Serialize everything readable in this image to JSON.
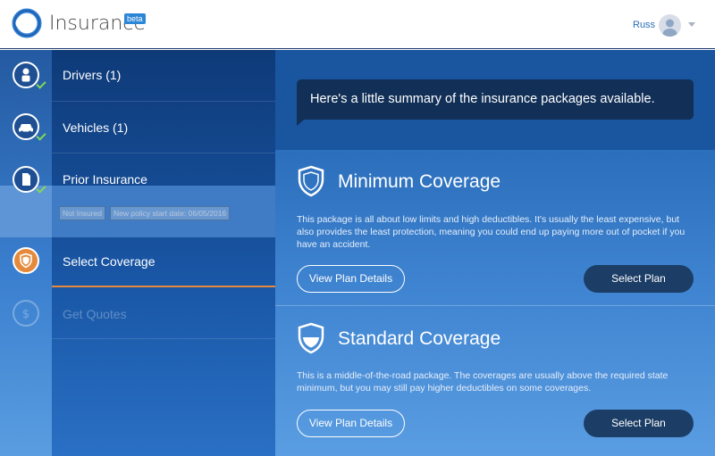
{
  "header": {
    "brand": "Insurance",
    "beta_label": "beta",
    "user_name": "Russ"
  },
  "sidebar": {
    "items": [
      {
        "label": "Drivers (1)",
        "icon": "person-icon",
        "completed": true
      },
      {
        "label": "Vehicles (1)",
        "icon": "car-icon",
        "completed": true
      },
      {
        "label": "Prior Insurance",
        "icon": "document-icon",
        "completed": true,
        "tags": [
          "Not Insured",
          "New policy start date: 06/05/2016"
        ]
      },
      {
        "label": "Select Coverage",
        "icon": "shield-icon",
        "active": true
      },
      {
        "label": "Get Quotes",
        "icon": "dollar-icon",
        "disabled": true
      }
    ]
  },
  "main": {
    "summary": "Here's a little summary of the insurance packages available.",
    "cards": [
      {
        "title": "Minimum Coverage",
        "description": "This package is all about low limits and high deductibles. It's usually the least expensive, but also provides the least protection, meaning you could end up paying more out of pocket if you have an accident.",
        "details_label": "View Plan Details",
        "select_label": "Select Plan"
      },
      {
        "title": "Standard Coverage",
        "description": "This is a middle-of-the-road package. The coverages are usually above the required state minimum, but you may still pay higher deductibles on some coverages.",
        "details_label": "View Plan Details",
        "select_label": "Select Plan"
      }
    ]
  },
  "colors": {
    "accent": "#e58a3c",
    "check": "#7ed957",
    "button_dark": "#1c3e66"
  }
}
